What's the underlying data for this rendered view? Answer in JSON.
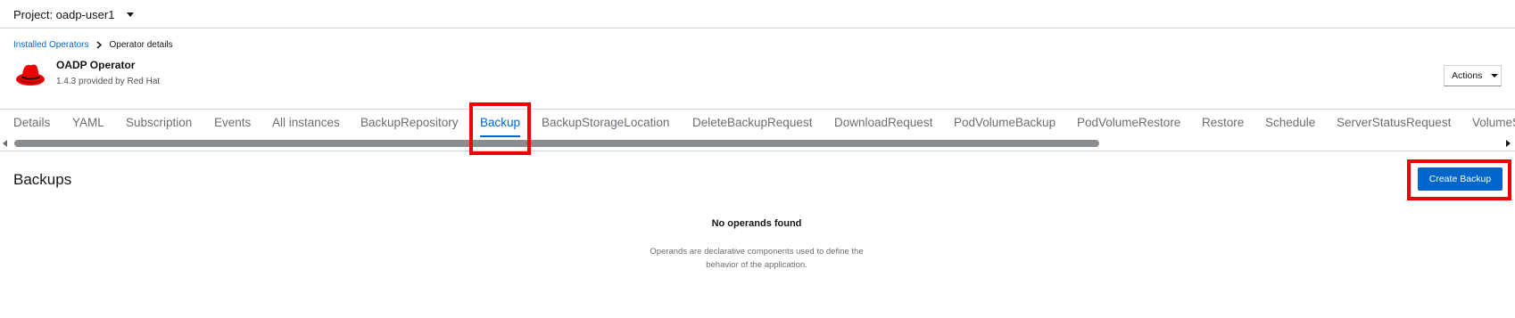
{
  "project": {
    "label": "Project: oadp-user1"
  },
  "breadcrumb": {
    "parent": "Installed Operators",
    "current": "Operator details"
  },
  "operator": {
    "name": "OADP Operator",
    "version": "1.4.3 provided by Red Hat",
    "logo_icon": "redhat-fedora-icon"
  },
  "actions": {
    "label": "Actions"
  },
  "tabs": [
    {
      "label": "Details"
    },
    {
      "label": "YAML"
    },
    {
      "label": "Subscription"
    },
    {
      "label": "Events"
    },
    {
      "label": "All instances"
    },
    {
      "label": "BackupRepository"
    },
    {
      "label": "Backup"
    },
    {
      "label": "BackupStorageLocation"
    },
    {
      "label": "DeleteBackupRequest"
    },
    {
      "label": "DownloadRequest"
    },
    {
      "label": "PodVolumeBackup"
    },
    {
      "label": "PodVolumeRestore"
    },
    {
      "label": "Restore"
    },
    {
      "label": "Schedule"
    },
    {
      "label": "ServerStatusRequest"
    },
    {
      "label": "VolumeS"
    }
  ],
  "active_tab": "Backup",
  "main": {
    "title": "Backups",
    "create_label": "Create Backup",
    "empty_title": "No operands found",
    "empty_desc_line1": "Operands are declarative components used to define the",
    "empty_desc_line2": "behavior of the application."
  },
  "colors": {
    "link": "#0066cc",
    "primary": "#0066cc",
    "highlight": "#ee0000",
    "redhat": "#ee0000"
  }
}
